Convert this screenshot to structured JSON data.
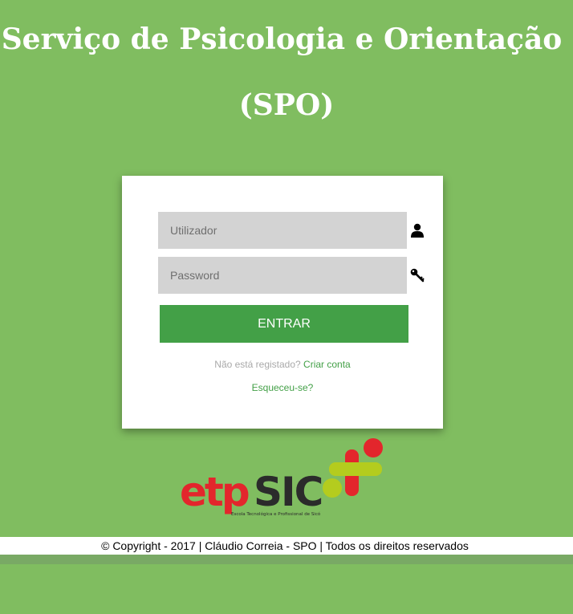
{
  "header": {
    "title_line1": "Serviço de Psicologia e Orientação",
    "title_line2": "(SPO)"
  },
  "login": {
    "username_placeholder": "Utilizador",
    "password_placeholder": "Password",
    "submit_label": "ENTRAR",
    "register_prompt": "Não está registado?",
    "register_link": "Criar conta",
    "forgot_link": "Esqueceu-se?"
  },
  "icons": {
    "username": "user-icon",
    "password": "key-icon"
  },
  "logo": {
    "wordmark": "etpsic",
    "tagline": "Escola Tecnológica e Profissional de Sicó"
  },
  "footer": {
    "copyright": "© Copyright - 2017 | Cláudio Correia - SPO | Todos os direitos reservados"
  },
  "colors": {
    "background": "#80bd60",
    "accent": "#43a047",
    "logo_red": "#e3262c",
    "logo_lime": "#b4cc1e"
  }
}
